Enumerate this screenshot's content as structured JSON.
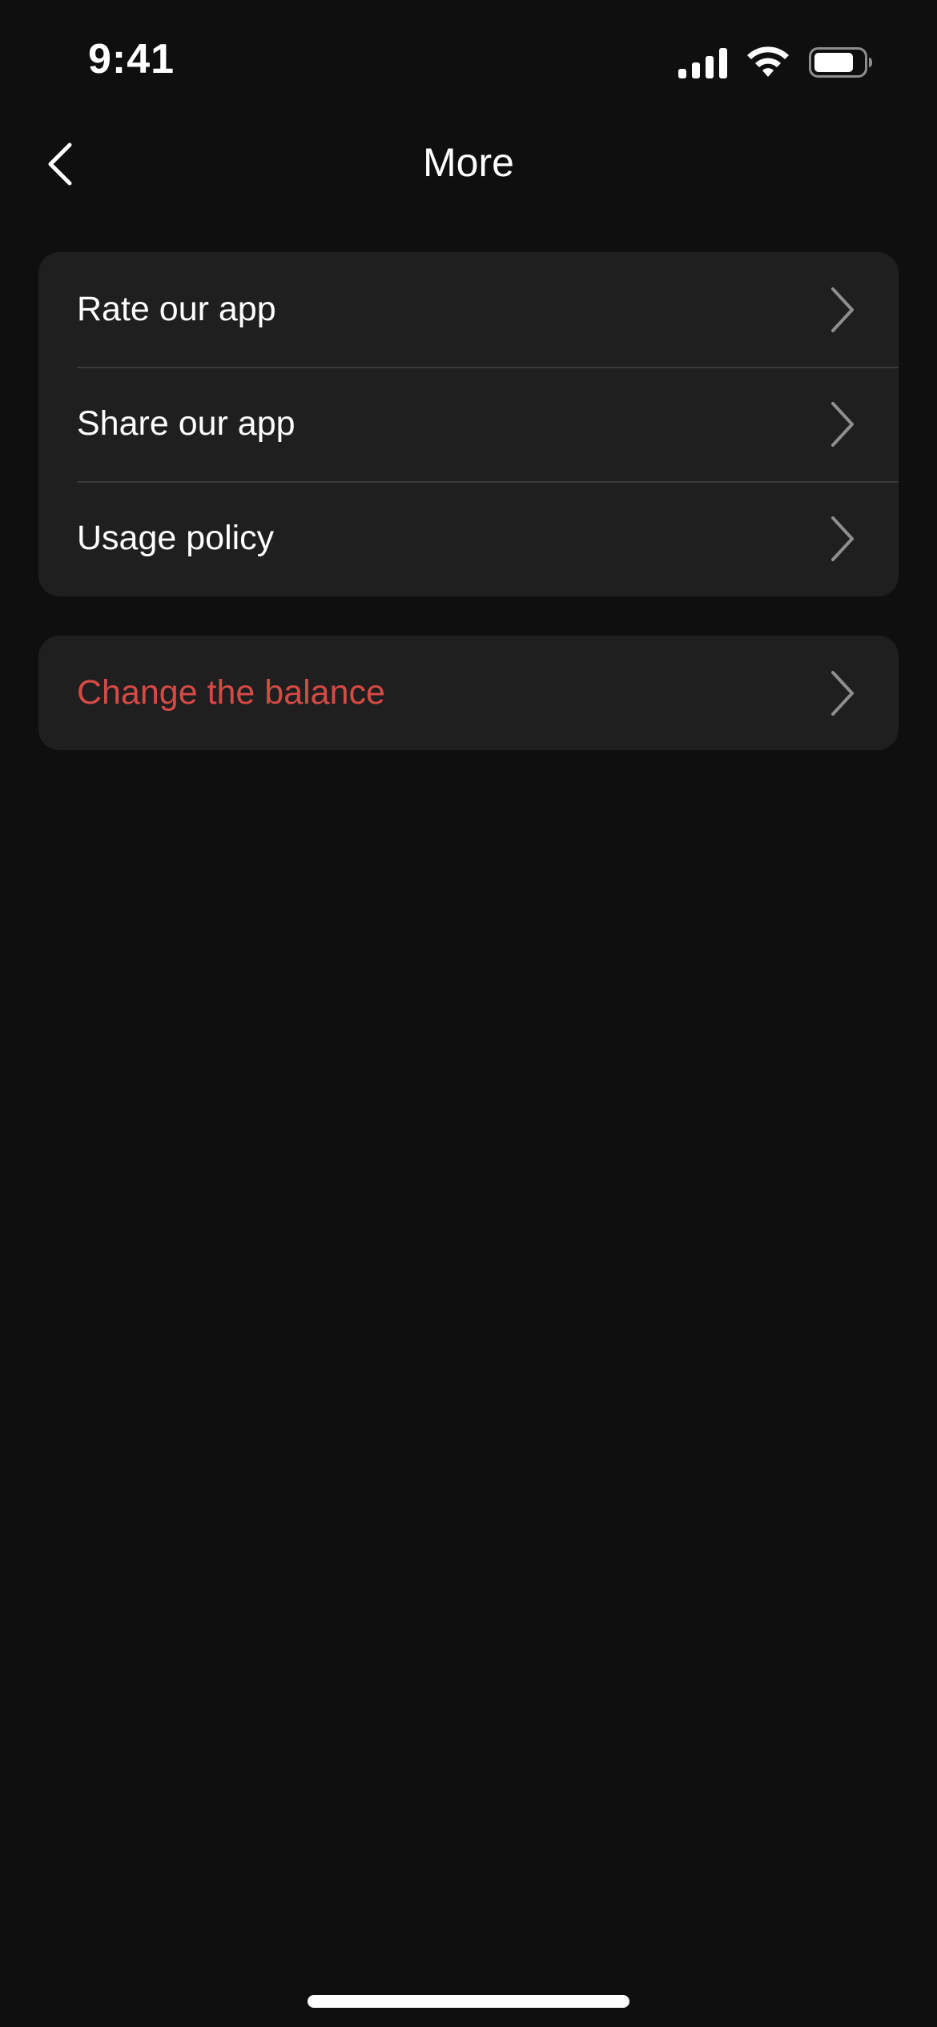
{
  "status_bar": {
    "time": "9:41",
    "icons": [
      "cellular-signal-icon",
      "wifi-icon",
      "battery-icon"
    ]
  },
  "nav": {
    "title": "More",
    "back_icon": "chevron-left-icon"
  },
  "groups": [
    {
      "items": [
        {
          "label": "Rate our app",
          "icon": "chevron-right-icon"
        },
        {
          "label": "Share our app",
          "icon": "chevron-right-icon"
        },
        {
          "label": "Usage policy",
          "icon": "chevron-right-icon"
        }
      ]
    },
    {
      "items": [
        {
          "label": "Change the balance",
          "icon": "chevron-right-icon",
          "style": "danger"
        }
      ]
    }
  ],
  "colors": {
    "background": "#0f0f0f",
    "card": "#1f1f1f",
    "separator": "#3a3a3a",
    "text": "#ffffff",
    "danger": "#d64a46",
    "chevron": "#8e8e8e"
  }
}
